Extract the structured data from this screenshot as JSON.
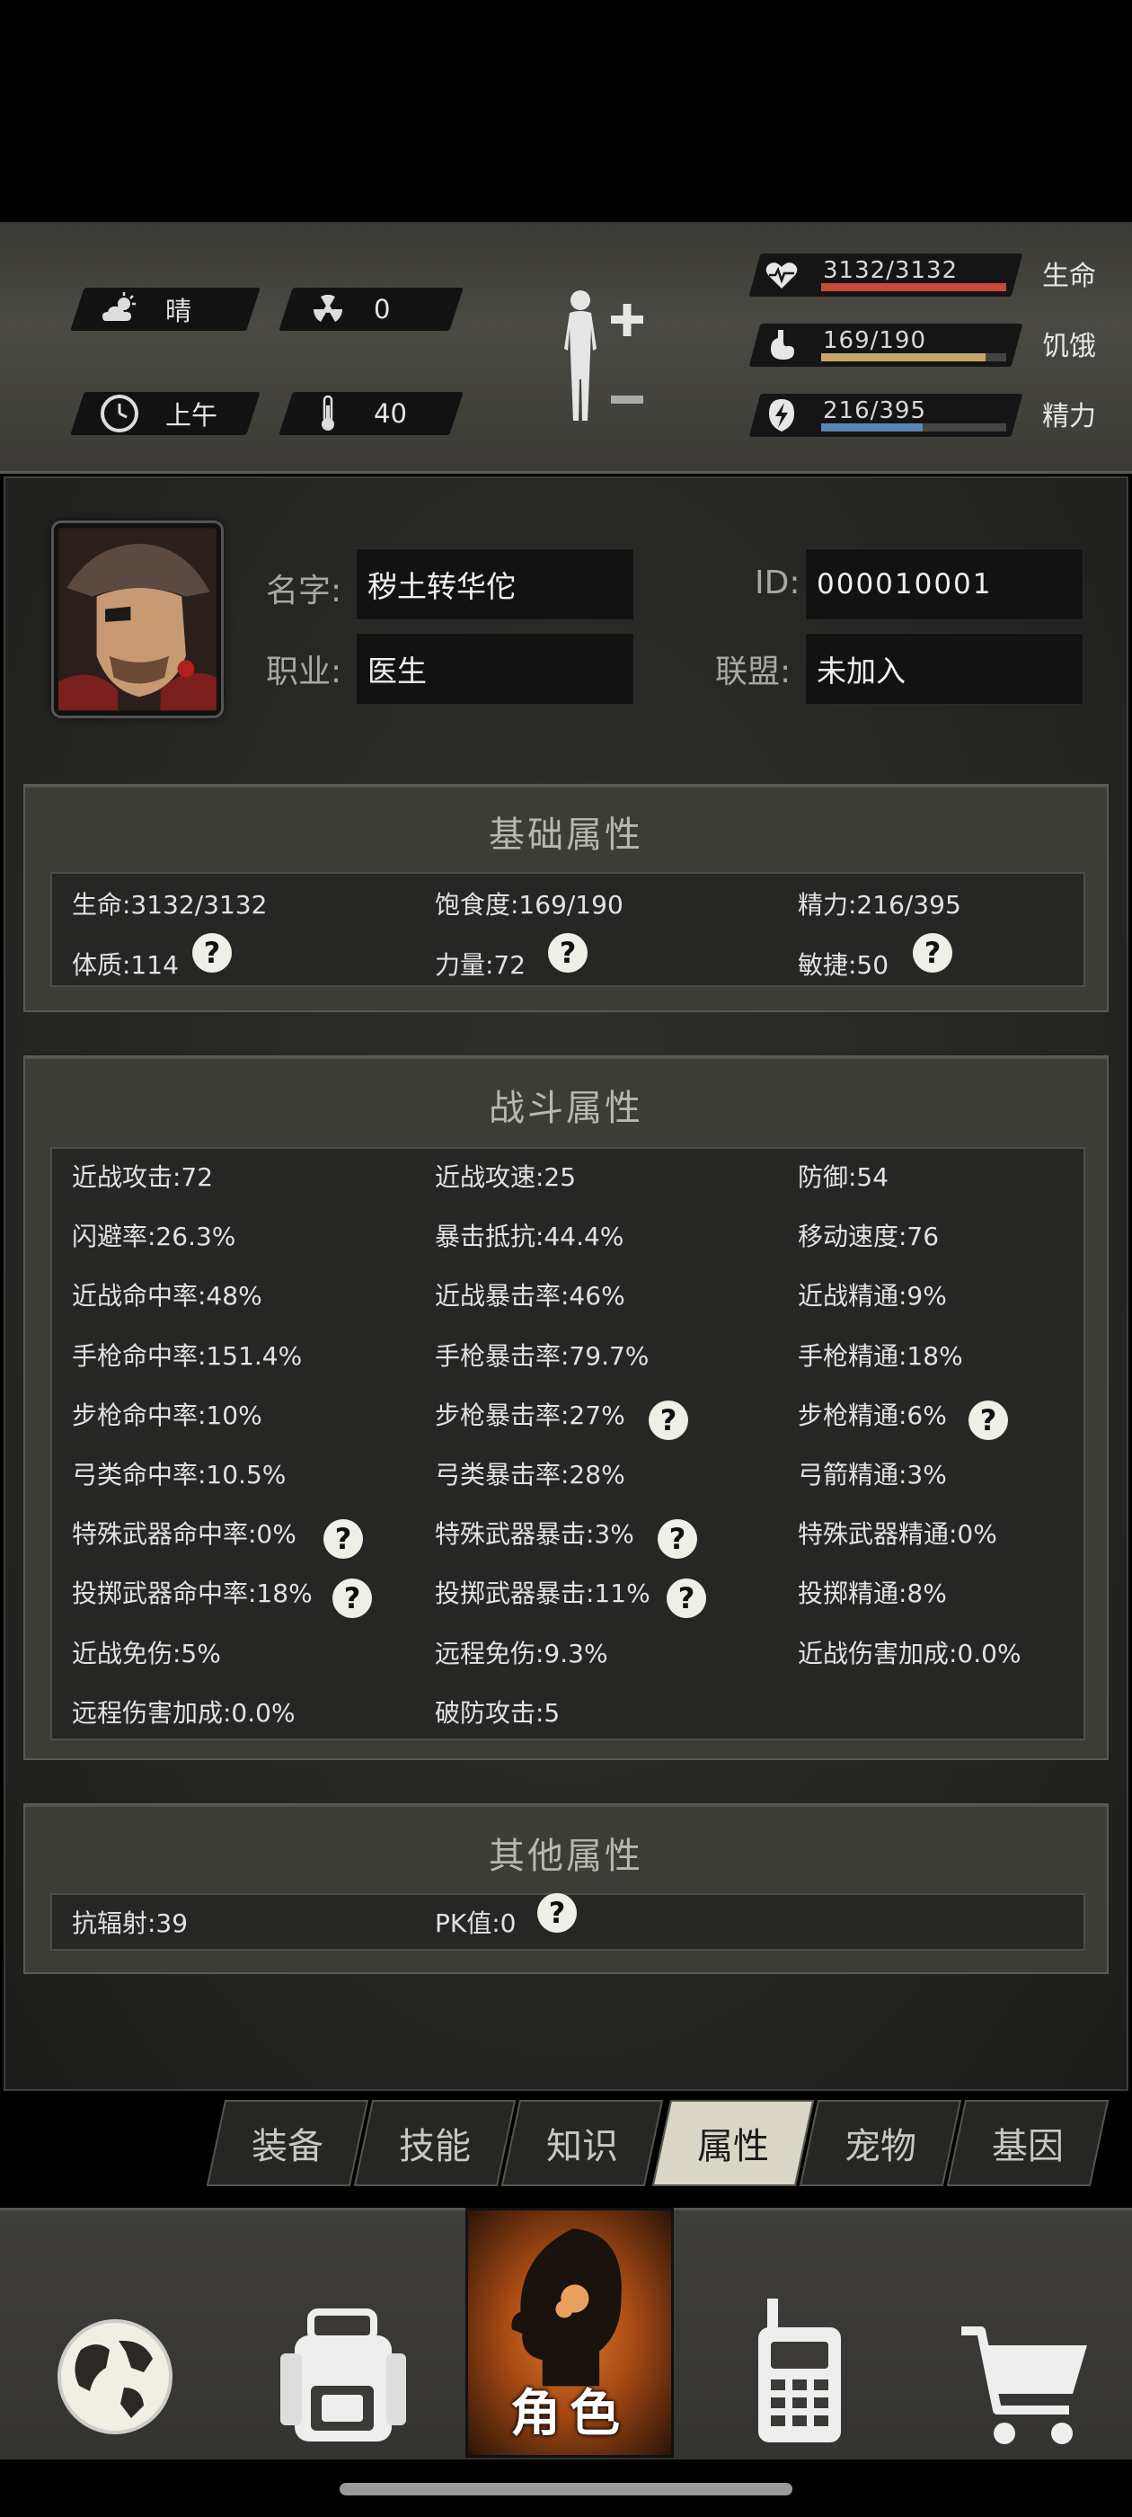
{
  "hud": {
    "weather": "晴",
    "radiation": "0",
    "time_of_day": "上午",
    "temperature": "40",
    "weather_icon": "cloud-sun-icon",
    "radiation_icon": "radiation-icon",
    "clock_icon": "clock-icon",
    "thermometer_icon": "thermometer-icon",
    "stats": [
      {
        "value": "3132/3132",
        "label": "生命",
        "fraction": 1.0,
        "color": "#c84a3a",
        "icon": "heart-icon"
      },
      {
        "value": "169/190",
        "label": "饥饿",
        "fraction": 0.889,
        "color": "#c7a66a",
        "icon": "stomach-icon"
      },
      {
        "value": "216/395",
        "label": "精力",
        "fraction": 0.547,
        "color": "#5b86b8",
        "icon": "energy-icon"
      }
    ]
  },
  "profile": {
    "name_label": "名字:",
    "name": "秽土转华佗",
    "job_label": "职业:",
    "job": "医生",
    "id_label": "ID:",
    "id": "000010001",
    "alliance_label": "联盟:",
    "alliance": "未加入"
  },
  "basic": {
    "title": "基础属性",
    "items": [
      "生命:3132/3132",
      "饱食度:169/190",
      "精力:216/395",
      "体质:114",
      "力量:72",
      "敏捷:50"
    ]
  },
  "combat": {
    "title": "战斗属性",
    "items": [
      "近战攻击:72",
      "近战攻速:25",
      "防御:54",
      "闪避率:26.3%",
      "暴击抵抗:44.4%",
      "移动速度:76",
      "近战命中率:48%",
      "近战暴击率:46%",
      "近战精通:9%",
      "手枪命中率:151.4%",
      "手枪暴击率:79.7%",
      "手枪精通:18%",
      "步枪命中率:10%",
      "步枪暴击率:27%",
      "步枪精通:6%",
      "弓类命中率:10.5%",
      "弓类暴击率:28%",
      "弓箭精通:3%",
      "特殊武器命中率:0%",
      "特殊武器暴击:3%",
      "特殊武器精通:0%",
      "投掷武器命中率:18%",
      "投掷武器暴击:11%",
      "投掷精通:8%",
      "近战免伤:5%",
      "远程免伤:9.3%",
      "近战伤害加成:0.0%",
      "远程伤害加成:0.0%",
      "破防攻击:5"
    ]
  },
  "other": {
    "title": "其他属性",
    "items": [
      "抗辐射:39",
      "PK值:0"
    ]
  },
  "help_glyph": "?",
  "tabs": [
    "装备",
    "技能",
    "知识",
    "属性",
    "宠物",
    "基因"
  ],
  "active_tab": "属性",
  "nav": {
    "items": [
      "globe-icon",
      "backpack-icon",
      "character-icon",
      "radio-icon",
      "cart-icon"
    ],
    "active_label": "角色"
  }
}
